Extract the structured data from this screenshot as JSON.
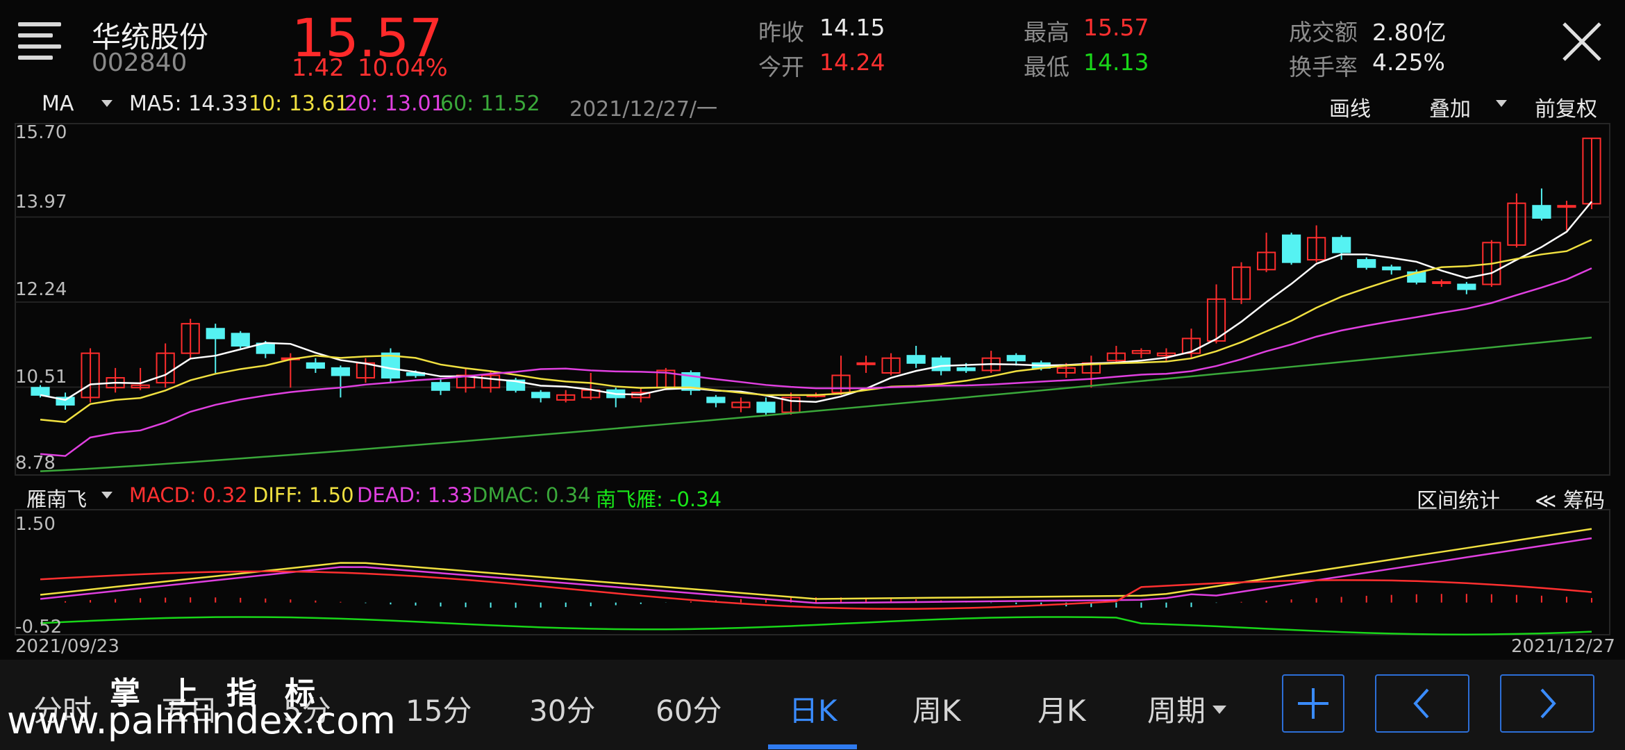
{
  "header": {
    "stock_name": "华统股份",
    "stock_code": "002840",
    "price": "15.57",
    "change": "1.42",
    "change_pct": "10.04%",
    "quotes": [
      {
        "label": "昨收",
        "value": "14.15",
        "color": "white"
      },
      {
        "label": "今开",
        "value": "14.24",
        "color": "red"
      },
      {
        "label": "最高",
        "value": "15.57",
        "color": "red"
      },
      {
        "label": "最低",
        "value": "14.13",
        "color": "green"
      },
      {
        "label": "成交额",
        "value": "2.80亿",
        "color": "white"
      },
      {
        "label": "换手率",
        "value": "4.25%",
        "color": "white"
      }
    ]
  },
  "ma_bar": {
    "indicator": "MA",
    "ma5": "MA5: 14.33",
    "ma10": "10: 13.61",
    "ma20": "20: 13.01",
    "ma60": "60: 11.52",
    "date": "2021/12/27/一",
    "draw_label": "画线",
    "overlay_label": "叠加",
    "adjust_label": "前复权"
  },
  "main_axis": [
    "15.70",
    "13.97",
    "12.24",
    "10.51",
    "8.78"
  ],
  "sub_bar": {
    "indicator": "雁南飞",
    "macd": "MACD: 0.32",
    "diff": "DIFF: 1.50",
    "dead": "DEAD: 1.33",
    "dmac": "DMAC: 0.34",
    "nfy": "南飞雁: -0.34",
    "range_stats": "区间统计",
    "chips": "≪ 筹码"
  },
  "sub_axis": [
    "1.50",
    "-0.52"
  ],
  "date_range": {
    "start": "2021/09/23",
    "end": "2021/12/27"
  },
  "tabs": [
    "分时",
    "五日",
    "5分",
    "15分",
    "30分",
    "60分",
    "日K",
    "周K",
    "月K",
    "周期"
  ],
  "active_tab": "日K",
  "watermark": {
    "url": "www.palmindex.com",
    "cn": "掌上指标"
  },
  "colors": {
    "up": "#ff2d2d",
    "down": "#55f2f2",
    "ma5": "#ffffff",
    "ma10": "#f0e040",
    "ma20": "#e040e0",
    "ma60": "#3aa83a",
    "accent": "#3a8cff"
  },
  "chart_data": {
    "type": "line",
    "ylim": [
      8.78,
      15.7
    ],
    "ma5_end": 14.33,
    "ma10_end": 13.61,
    "ma20_end": 13.01,
    "ma60_end": 11.52,
    "candles": [
      [
        10.5,
        10.35,
        10.55,
        10.3
      ],
      [
        10.3,
        10.15,
        10.4,
        10.05
      ],
      [
        10.3,
        11.2,
        11.3,
        10.2
      ],
      [
        10.5,
        10.7,
        10.9,
        10.4
      ],
      [
        10.5,
        10.55,
        10.9,
        10.45
      ],
      [
        10.6,
        11.2,
        11.4,
        10.5
      ],
      [
        11.2,
        11.8,
        11.9,
        11.1
      ],
      [
        11.7,
        11.5,
        11.8,
        10.8
      ],
      [
        11.6,
        11.35,
        11.65,
        11.3
      ],
      [
        11.4,
        11.2,
        11.45,
        11.1
      ],
      [
        11.1,
        11.1,
        11.2,
        10.5
      ],
      [
        11.0,
        10.9,
        11.1,
        10.8
      ],
      [
        10.9,
        10.75,
        10.95,
        10.3
      ],
      [
        10.7,
        11.0,
        11.1,
        10.6
      ],
      [
        11.2,
        10.7,
        11.3,
        10.6
      ],
      [
        10.8,
        10.75,
        10.85,
        10.7
      ],
      [
        10.6,
        10.45,
        10.7,
        10.35
      ],
      [
        10.5,
        10.75,
        10.9,
        10.4
      ],
      [
        10.5,
        10.75,
        10.85,
        10.4
      ],
      [
        10.65,
        10.45,
        10.7,
        10.4
      ],
      [
        10.4,
        10.3,
        10.45,
        10.2
      ],
      [
        10.25,
        10.35,
        10.45,
        10.2
      ],
      [
        10.3,
        10.45,
        10.8,
        10.25
      ],
      [
        10.45,
        10.3,
        10.5,
        10.1
      ],
      [
        10.3,
        10.4,
        10.5,
        10.2
      ],
      [
        10.5,
        10.85,
        10.9,
        10.45
      ],
      [
        10.8,
        10.45,
        10.85,
        10.35
      ],
      [
        10.3,
        10.2,
        10.35,
        10.1
      ],
      [
        10.1,
        10.2,
        10.3,
        10.0
      ],
      [
        10.2,
        10.0,
        10.3,
        9.95
      ],
      [
        10.0,
        10.3,
        10.4,
        9.95
      ],
      [
        10.35,
        10.35,
        10.4,
        10.3
      ],
      [
        10.4,
        10.75,
        11.15,
        10.35
      ],
      [
        11.0,
        11.0,
        11.15,
        10.8
      ],
      [
        10.8,
        11.1,
        11.2,
        10.75
      ],
      [
        11.15,
        11.0,
        11.35,
        10.9
      ],
      [
        11.1,
        10.85,
        11.15,
        10.75
      ],
      [
        10.9,
        10.85,
        11.0,
        10.8
      ],
      [
        10.85,
        11.1,
        11.25,
        10.8
      ],
      [
        11.15,
        11.05,
        11.2,
        10.95
      ],
      [
        11.0,
        10.9,
        11.05,
        10.85
      ],
      [
        10.8,
        10.9,
        11.0,
        10.7
      ],
      [
        10.8,
        11.0,
        11.15,
        10.5
      ],
      [
        11.05,
        11.2,
        11.35,
        11.0
      ],
      [
        11.2,
        11.25,
        11.3,
        11.1
      ],
      [
        11.15,
        11.2,
        11.3,
        11.05
      ],
      [
        11.2,
        11.5,
        11.7,
        11.1
      ],
      [
        11.45,
        12.3,
        12.6,
        11.4
      ],
      [
        12.3,
        12.95,
        13.05,
        12.2
      ],
      [
        12.9,
        13.25,
        13.65,
        12.85
      ],
      [
        13.6,
        13.05,
        13.65,
        13.0
      ],
      [
        13.1,
        13.55,
        13.8,
        13.05
      ],
      [
        13.55,
        13.25,
        13.6,
        13.1
      ],
      [
        13.1,
        12.95,
        13.15,
        12.9
      ],
      [
        12.95,
        12.9,
        13.0,
        12.8
      ],
      [
        12.85,
        12.65,
        12.9,
        12.6
      ],
      [
        12.65,
        12.65,
        12.7,
        12.55
      ],
      [
        12.6,
        12.5,
        12.65,
        12.4
      ],
      [
        12.6,
        13.45,
        13.5,
        12.55
      ],
      [
        13.4,
        14.25,
        14.45,
        13.35
      ],
      [
        14.2,
        13.95,
        14.55,
        13.9
      ],
      [
        14.2,
        14.2,
        14.3,
        13.7
      ],
      [
        14.24,
        15.57,
        15.57,
        14.13
      ]
    ]
  }
}
